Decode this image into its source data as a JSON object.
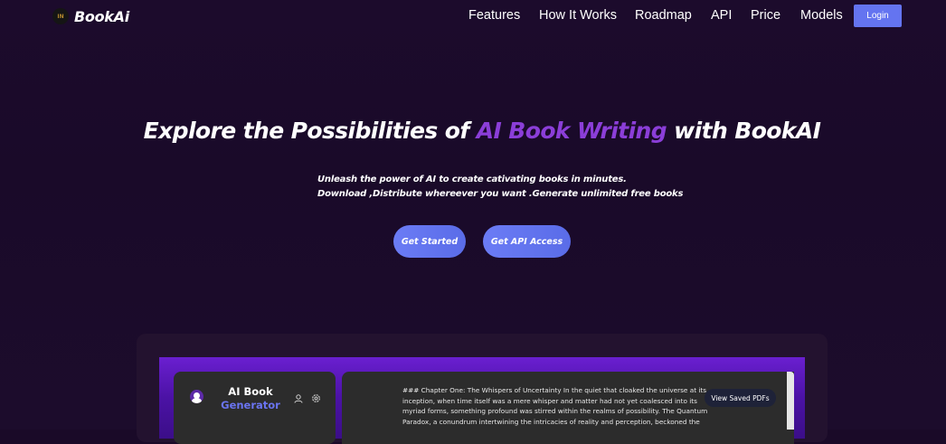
{
  "navbar": {
    "brand": "BookAi",
    "logo_mark": "IN",
    "links": [
      "Features",
      "How It Works",
      "Roadmap",
      "API",
      "Price",
      "Models"
    ],
    "login_label": "Login"
  },
  "hero": {
    "title_start": "Explore the Possibilities of ",
    "title_accent": "AI Book Writing",
    "title_end": " with BookAI",
    "subtitle_line1": "Unleash the power of AI to create cativating books in minutes.",
    "subtitle_line2": "Download ,Distribute whereever you want .Generate unlimited free books",
    "cta_primary": "Get Started",
    "cta_secondary": "Get API Access"
  },
  "preview": {
    "generator_title_line1": "AI Book",
    "generator_title_line2": "Generator",
    "doc_lines": [
      "### Chapter One: The Whispers of Uncertainty In the quiet that cloaked the universe at its",
      "inception, when time itself was a mere whisper and matter had not yet coalesced into its",
      "myriad forms, something profound was stirred within the realms of possibility. The Quantum",
      "Paradox, a conundrum intertwining the intricacies of reality and perception, beckoned the"
    ],
    "view_pdfs_label": "View Saved PDFs"
  },
  "colors": {
    "background": "#1a0a28",
    "accent_purple": "#8b3ed8",
    "button_blue": "#6474f0",
    "generator_accent": "#6a74f0"
  },
  "icons": [
    "user-icon",
    "gear-icon",
    "avatar-icon"
  ]
}
